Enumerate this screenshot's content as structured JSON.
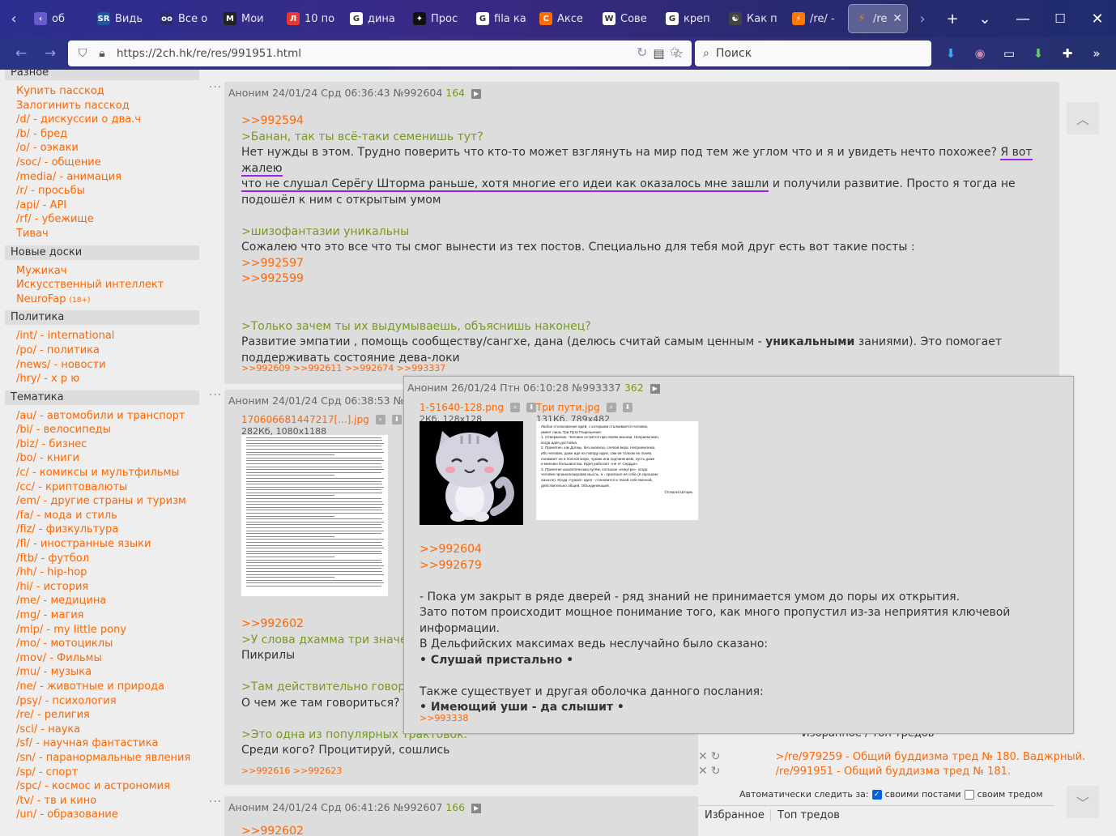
{
  "browser": {
    "tabs": [
      {
        "label": "об",
        "fav": "‹",
        "color": "#6a5acd"
      },
      {
        "label": "Видь",
        "fav": "SR",
        "color": "#1e56a0"
      },
      {
        "label": "Все о",
        "fav": "oo",
        "color": "#2d2d6b"
      },
      {
        "label": "Мои",
        "fav": "M",
        "color": "#222"
      },
      {
        "label": "10 по",
        "fav": "Л",
        "color": "#e53935"
      },
      {
        "label": "дина",
        "fav": "G",
        "color": "#ffffff"
      },
      {
        "label": "Прос",
        "fav": "✦",
        "color": "#111"
      },
      {
        "label": "fila ка",
        "fav": "G",
        "color": "#ffffff"
      },
      {
        "label": "Аксе",
        "fav": "C",
        "color": "#ff6d00"
      },
      {
        "label": "Сове",
        "fav": "W",
        "color": "#ffffff"
      },
      {
        "label": "креп",
        "fav": "G",
        "color": "#ffffff"
      },
      {
        "label": "Как п",
        "fav": "☯",
        "color": "#444"
      },
      {
        "label": "/re/ -",
        "fav": "⚡",
        "color": "#ff7800"
      }
    ],
    "active_tab": {
      "label": "/re",
      "fav": "⚡"
    },
    "url": "https://2ch.hk/re/res/991951.html",
    "search_placeholder": "Поиск",
    "icons": {
      "back": "←",
      "forward": "→",
      "new_tab": "+",
      "list_tabs": "⌄",
      "minimize": "—",
      "maximize": "☐",
      "close": "✕"
    }
  },
  "sidebar": {
    "sections": [
      {
        "title": "Разное",
        "items": [
          "Купить пасскод",
          "Залогинить пасскод",
          "/d/ - дискуссии о два.ч",
          "/b/ - бред",
          "/o/ - оэкаки",
          "/soc/ - общение",
          "/media/ - анимация",
          "/r/ - просьбы",
          "/api/ - API",
          "/rf/ - убежище",
          "Тивач"
        ]
      },
      {
        "title": "Новые доски",
        "items": [
          "Мужикач",
          "Искусственный интеллект",
          "NeuroFap"
        ],
        "adult_tag": "(18+)"
      },
      {
        "title": "Политика",
        "items": [
          "/int/ - international",
          "/po/ - политика",
          "/news/ - новости",
          "/hry/ - х р ю"
        ]
      },
      {
        "title": "Тематика",
        "items": [
          "/au/ - автомобили и транспорт",
          "/bi/ - велосипеды",
          "/biz/ - бизнес",
          "/bo/ - книги",
          "/c/ - комиксы и мультфильмы",
          "/cc/ - криптовалюты",
          "/em/ - другие страны и туризм",
          "/fa/ - мода и стиль",
          "/fiz/ - физкультура",
          "/fl/ - иностранные языки",
          "/ftb/ - футбол",
          "/hh/ - hip-hop",
          "/hi/ - история",
          "/me/ - медицина",
          "/mg/ - магия",
          "/mlp/ - my little pony",
          "/mo/ - мотоциклы",
          "/mov/ - Фильмы",
          "/mu/ - музыка",
          "/ne/ - животные и природа",
          "/psy/ - психология",
          "/re/ - религия",
          "/sci/ - наука",
          "/sf/ - научная фантастика",
          "/sn/ - паранормальные явления",
          "/sp/ - спорт",
          "/spc/ - космос и астрономия",
          "/tv/ - тв и кино",
          "/un/ - образование"
        ]
      }
    ]
  },
  "posts": {
    "p1": {
      "meta": "Аноним 24/01/24 Срд 06:36:43 №992604",
      "count": "164",
      "ref1": ">>992594",
      "q1": ">Банан, так ты всё-таки семенишь тут?",
      "t1a": "Нет нужды в этом. Трудно поверить что кто-то может взглянуть на мир под тем же углом что и я и увидеть нечто похожее? ",
      "t1b": "Я вот жалею",
      "t1c": "что не слушал Серёгу Шторма раньше, хотя многие его идеи как оказалось мне зашли",
      "t1d": " и получили развитие. Просто я тогда не подошёл к ним с открытым умом",
      "q2": ">шизофантазии уникальны",
      "t2": "Сожалею что это все что ты смог вынести из тех постов. Специально для тебя мой друг есть вот такие посты :",
      "ref2": ">>992597",
      "ref3": ">>992599",
      "q3": ">Только зачем ты их выдумываешь, объяснишь наконец?",
      "t3a": "Развитие эмпатии , помощь сообществу/сангхе, дана (делюсь считай самым ценным - ",
      "t3b": "уникальными",
      "t3c": " заниями). Это помогает",
      "t3d": "поддерживать состояние дева-локи",
      "replies": ">>992609 >>992611 >>992674 >>993337"
    },
    "p2": {
      "meta": "Аноним 24/01/24 Срд 06:38:53 №",
      "file": "170606681447217[...].jpg",
      "file_info": "282Кб, 1080x1188",
      "ref1": ">>992602",
      "q1": ">У слова дхамма три значен",
      "t1": "Пикрилы",
      "q2": ">Там действительно говорит",
      "t2": "О чем же там говориться? П",
      "q3": ">Это одна из популярных трактовок.",
      "t3": "Среди кого? Процитируй, сошлись",
      "replies": ">>992616 >>992623"
    },
    "p3": {
      "meta": "Аноним 24/01/24 Срд 06:41:26 №992607",
      "count": "166",
      "ref1": ">>992602"
    }
  },
  "popup": {
    "meta": "Аноним 26/01/24 Птн 06:10:28 №993337",
    "count": "362",
    "file1": "1-51640-128.png",
    "file1_info": "2Кб, 128x128",
    "file2": "Три пути.jpg",
    "file2_info": "131Кб, 789x482",
    "img2_lines": [
      "Любое столкновение идей, с которыми сталкивается человек,",
      "имеет лишь Три Пути Разрешения:",
      "1. Отвержение. Человек остаётся при своём мнении. Неприемлемо,",
      "когда идея достойна.",
      "2. Принятие, как Догмы, без анализа, слепая вера. Неприемлемо,",
      "ибо человек, даже идя на поводу идеи, сам её толком не поняв,",
      "понимает не в полной мере, чужим или подчинением, пусть даже",
      "и мнению большинства. Идея работает «не от Сердца».",
      "3. Принятие аналитических путём, согласие «изнутри», когда",
      "человек проанализировав мысль, и - присвоил её себе (в хорошем",
      "смысле). Когда «чужая» идея - становится и твоей собственной,",
      "действительно общей. Объединяющей."
    ],
    "img2_sign": "©Сергей Шторм.",
    "ref1": ">>992604",
    "ref2": ">>992679",
    "l1": "- Пока ум закрыт в ряде дверей - ряд знаний не принимается умом до поры их открытия.",
    "l2": "Зато потом происходит мощное понимание того, как много пропустил из-за неприятия ключевой информации.",
    "l3": "В Дельфийских максимах ведь неслучайно было сказано:",
    "l4": "• Слушай пристально •",
    "l5": "Также существует и другая оболочка данного послания:",
    "l6": "• Имеющий уши - да слышит •",
    "replies": ">>993338"
  },
  "favorites": {
    "header": "Избранное / Топ тредов",
    "rows": [
      ">/re/979259 - Общий буддизма тред № 180. Ваджрный.",
      "/re/991951 - Общий буддизма тред № 181."
    ],
    "auto_watch_label": "Автоматически следить за:",
    "opt1": "своими постами",
    "opt2": "своим тредом",
    "tab1": "Избранное",
    "tab2": "Топ тредов"
  }
}
